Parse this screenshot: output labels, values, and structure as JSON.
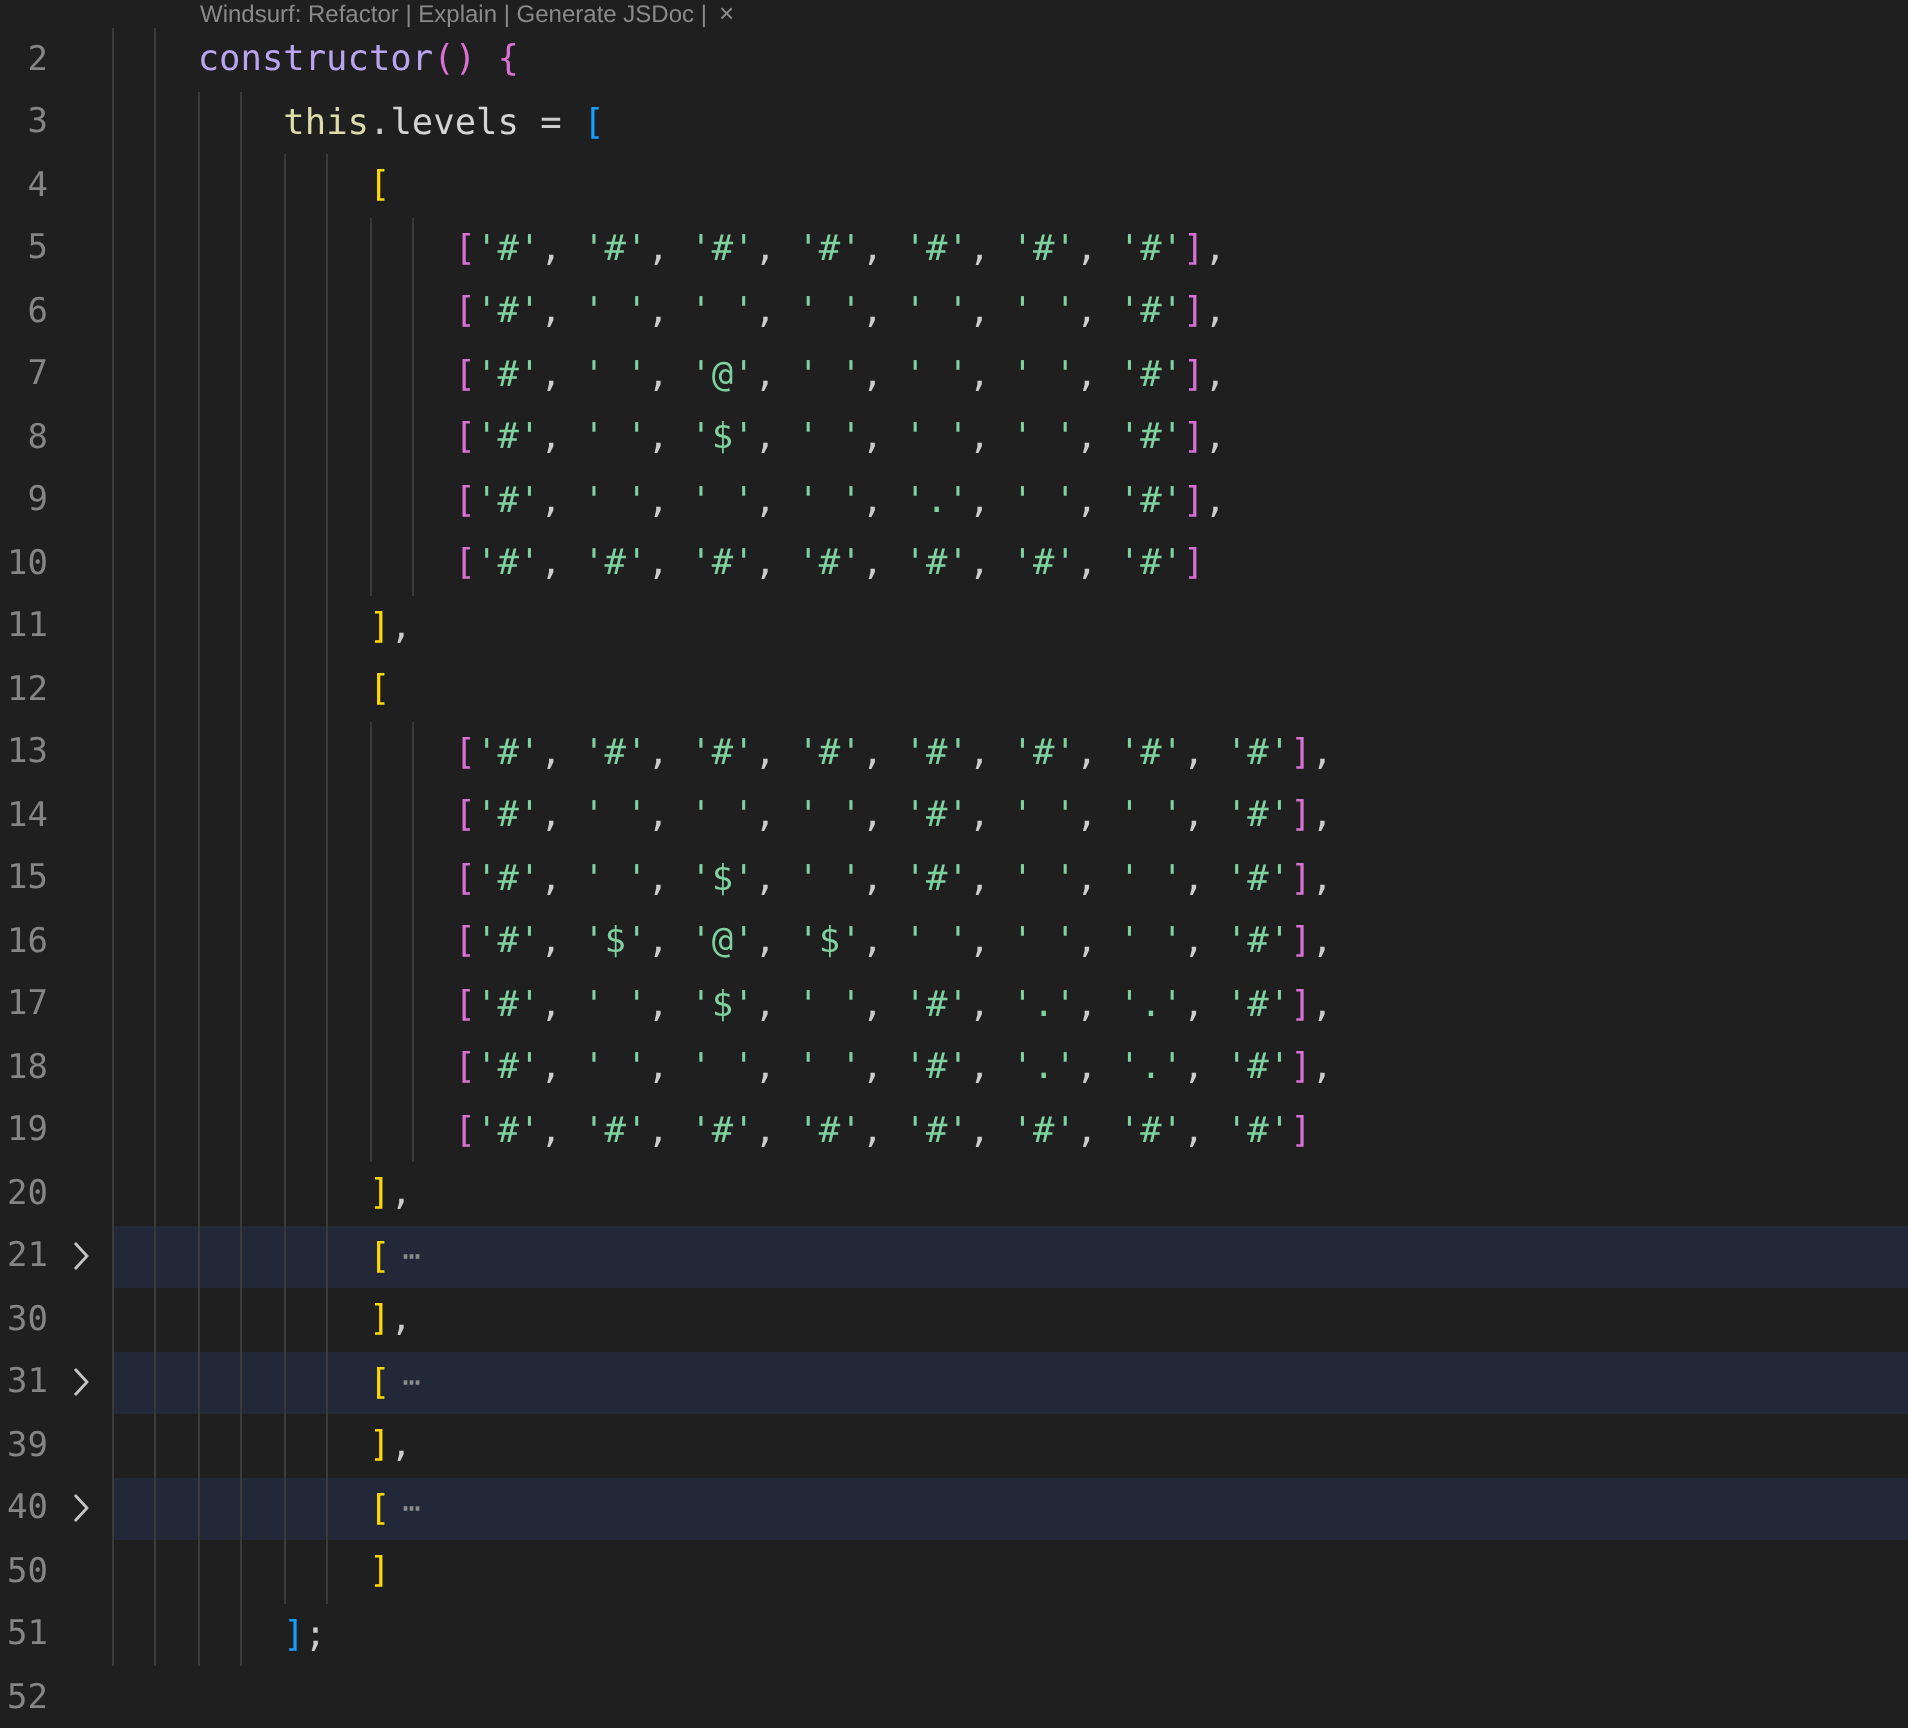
{
  "codelens": {
    "text": "Windsurf: Refactor | Explain | Generate JSDoc |",
    "close": "×"
  },
  "lines": [
    {
      "number": "2",
      "text": "    constructor() {",
      "collapsed": false
    },
    {
      "number": "3",
      "text": "        this.levels = [",
      "collapsed": false
    },
    {
      "number": "4",
      "text": "            [",
      "collapsed": false
    },
    {
      "number": "5",
      "text": "                ['#', '#', '#', '#', '#', '#', '#'],",
      "collapsed": false
    },
    {
      "number": "6",
      "text": "                ['#', ' ', ' ', ' ', ' ', ' ', '#'],",
      "collapsed": false
    },
    {
      "number": "7",
      "text": "                ['#', ' ', '@', ' ', ' ', ' ', '#'],",
      "collapsed": false
    },
    {
      "number": "8",
      "text": "                ['#', ' ', '$', ' ', ' ', ' ', '#'],",
      "collapsed": false
    },
    {
      "number": "9",
      "text": "                ['#', ' ', ' ', ' ', '.', ' ', '#'],",
      "collapsed": false
    },
    {
      "number": "10",
      "text": "                ['#', '#', '#', '#', '#', '#', '#']",
      "collapsed": false
    },
    {
      "number": "11",
      "text": "            ],",
      "collapsed": false
    },
    {
      "number": "12",
      "text": "            [",
      "collapsed": false
    },
    {
      "number": "13",
      "text": "                ['#', '#', '#', '#', '#', '#', '#', '#'],",
      "collapsed": false
    },
    {
      "number": "14",
      "text": "                ['#', ' ', ' ', ' ', '#', ' ', ' ', '#'],",
      "collapsed": false
    },
    {
      "number": "15",
      "text": "                ['#', ' ', '$', ' ', '#', ' ', ' ', '#'],",
      "collapsed": false
    },
    {
      "number": "16",
      "text": "                ['#', '$', '@', '$', ' ', ' ', ' ', '#'],",
      "collapsed": false
    },
    {
      "number": "17",
      "text": "                ['#', ' ', '$', ' ', '#', '.', '.', '#'],",
      "collapsed": false
    },
    {
      "number": "18",
      "text": "                ['#', ' ', ' ', ' ', '#', '.', '.', '#'],",
      "collapsed": false
    },
    {
      "number": "19",
      "text": "                ['#', '#', '#', '#', '#', '#', '#', '#']",
      "collapsed": false
    },
    {
      "number": "20",
      "text": "            ],",
      "collapsed": false
    },
    {
      "number": "21",
      "text": "            [",
      "collapsed": true,
      "ellipsis": "⋯"
    },
    {
      "number": "30",
      "text": "            ],",
      "collapsed": false
    },
    {
      "number": "31",
      "text": "            [",
      "collapsed": true,
      "ellipsis": "⋯"
    },
    {
      "number": "39",
      "text": "            ],",
      "collapsed": false
    },
    {
      "number": "40",
      "text": "            [",
      "collapsed": true,
      "ellipsis": "⋯"
    },
    {
      "number": "50",
      "text": "            ]",
      "collapsed": false
    },
    {
      "number": "51",
      "text": "        ];",
      "collapsed": false
    },
    {
      "number": "52",
      "collapsed": false
    }
  ]
}
